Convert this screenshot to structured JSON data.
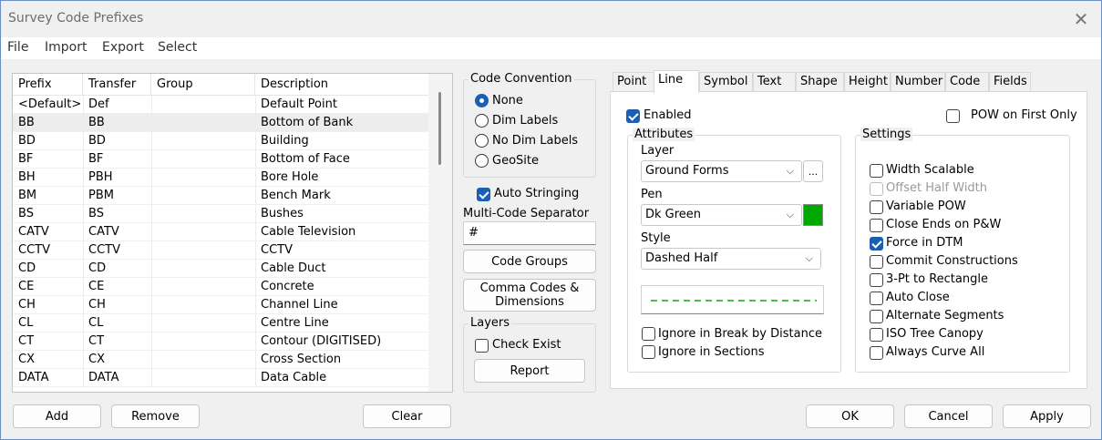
{
  "window": {
    "title": "Survey Code Prefixes",
    "close_glyph": "✕"
  },
  "menu": [
    "File",
    "Import",
    "Export",
    "Select"
  ],
  "list": {
    "columns": [
      "Prefix",
      "Transfer",
      "Group",
      "Description"
    ],
    "rows": [
      {
        "prefix": "<Default>",
        "transfer": "Def",
        "group": "",
        "description": "Default Point"
      },
      {
        "prefix": "BB",
        "transfer": "BB",
        "group": "",
        "description": "Bottom of Bank"
      },
      {
        "prefix": "BD",
        "transfer": "BD",
        "group": "",
        "description": "Building"
      },
      {
        "prefix": "BF",
        "transfer": "BF",
        "group": "",
        "description": "Bottom of Face"
      },
      {
        "prefix": "BH",
        "transfer": "PBH",
        "group": "",
        "description": "Bore Hole"
      },
      {
        "prefix": "BM",
        "transfer": "PBM",
        "group": "",
        "description": "Bench Mark"
      },
      {
        "prefix": "BS",
        "transfer": "BS",
        "group": "",
        "description": "Bushes"
      },
      {
        "prefix": "CATV",
        "transfer": "CATV",
        "group": "",
        "description": "Cable Television"
      },
      {
        "prefix": "CCTV",
        "transfer": "CCTV",
        "group": "",
        "description": "CCTV"
      },
      {
        "prefix": "CD",
        "transfer": "CD",
        "group": "",
        "description": "Cable Duct"
      },
      {
        "prefix": "CE",
        "transfer": "CE",
        "group": "",
        "description": "Concrete"
      },
      {
        "prefix": "CH",
        "transfer": "CH",
        "group": "",
        "description": "Channel Line"
      },
      {
        "prefix": "CL",
        "transfer": "CL",
        "group": "",
        "description": "Centre Line"
      },
      {
        "prefix": "CT",
        "transfer": "CT",
        "group": "",
        "description": "Contour (DIGITISED)"
      },
      {
        "prefix": "CX",
        "transfer": "CX",
        "group": "",
        "description": "Cross Section"
      },
      {
        "prefix": "DATA",
        "transfer": "DATA",
        "group": "",
        "description": "Data Cable"
      }
    ],
    "selected_index": 1
  },
  "bottom_left_buttons": {
    "add": "Add",
    "remove": "Remove",
    "clear": "Clear"
  },
  "code_convention": {
    "label": "Code Convention",
    "options": [
      "None",
      "Dim Labels",
      "No Dim Labels",
      "GeoSite"
    ],
    "selected": "None"
  },
  "auto_stringing": {
    "label": "Auto Stringing",
    "checked": true
  },
  "multi_code": {
    "label": "Multi-Code Separator",
    "value": "#"
  },
  "middle_buttons": {
    "code_groups": "Code Groups",
    "comma_codes_1": "Comma Codes &",
    "comma_codes_2": "Dimensions"
  },
  "layers": {
    "label": "Layers",
    "check_exist": "Check Exist",
    "check_exist_checked": false,
    "report": "Report"
  },
  "tabs": [
    "Point",
    "Line",
    "Symbol",
    "Text",
    "Shape",
    "Height",
    "Number",
    "Code",
    "Fields"
  ],
  "active_tab": "Line",
  "line_tab": {
    "enabled_label": "Enabled",
    "enabled": true,
    "pow_first_label": "POW on First Only",
    "pow_first": false,
    "attributes_label": "Attributes",
    "layer_label": "Layer",
    "layer_value": "Ground Forms",
    "browse_label": "...",
    "pen_label": "Pen",
    "pen_value": "Dk Green",
    "pen_color": "#00a800",
    "style_label": "Style",
    "style_value": "Dashed Half",
    "line_preview_color": "#1aa01a",
    "ignore_break_label": "Ignore in Break by Distance",
    "ignore_sections_label": "Ignore in Sections",
    "settings_label": "Settings",
    "settings": [
      {
        "label": "Width Scalable",
        "checked": false,
        "disabled": false
      },
      {
        "label": "Offset Half Width",
        "checked": false,
        "disabled": true
      },
      {
        "label": "Variable POW",
        "checked": false,
        "disabled": false
      },
      {
        "label": "Close Ends on P&W",
        "checked": false,
        "disabled": false
      },
      {
        "label": "Force in DTM",
        "checked": true,
        "disabled": false
      },
      {
        "label": "Commit Constructions",
        "checked": false,
        "disabled": false
      },
      {
        "label": "3-Pt to Rectangle",
        "checked": false,
        "disabled": false
      },
      {
        "label": "Auto Close",
        "checked": false,
        "disabled": false
      },
      {
        "label": "Alternate Segments",
        "checked": false,
        "disabled": false
      },
      {
        "label": "ISO Tree Canopy",
        "checked": false,
        "disabled": false
      },
      {
        "label": "Always Curve All",
        "checked": false,
        "disabled": false
      }
    ]
  },
  "dialog_buttons": {
    "ok": "OK",
    "cancel": "Cancel",
    "apply": "Apply"
  },
  "colors": {
    "accent": "#1a5fb4"
  }
}
